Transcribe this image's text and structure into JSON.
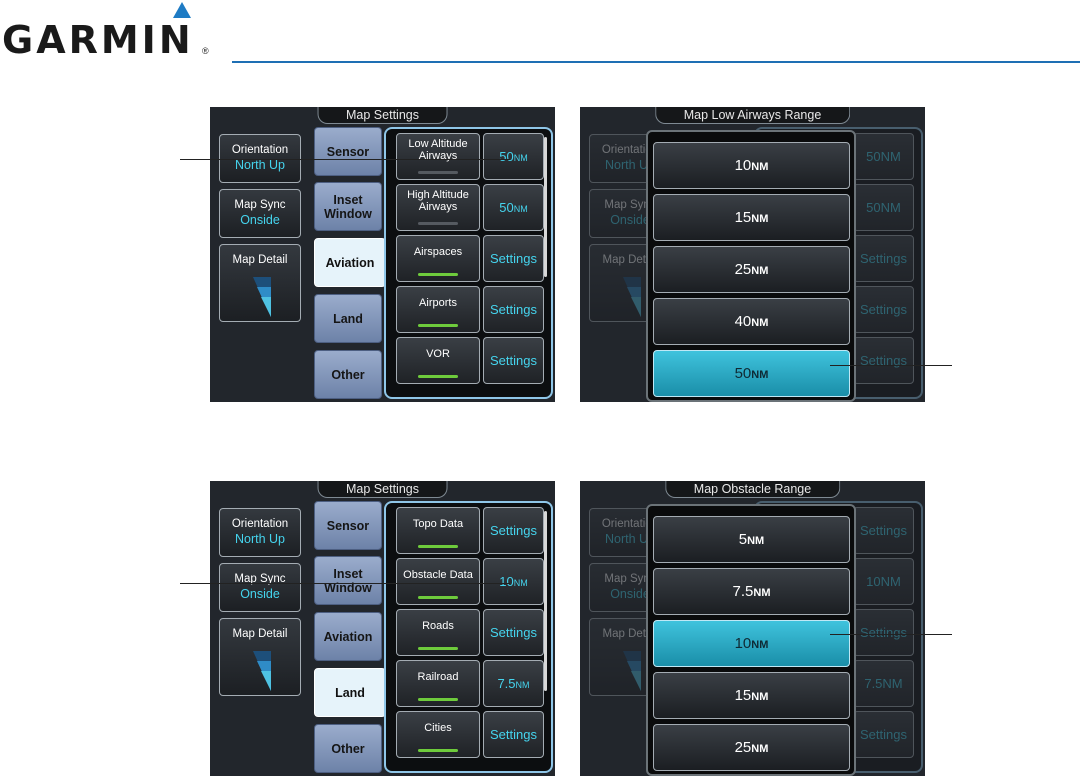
{
  "brand": {
    "name": "GARMIN",
    "mark": "®"
  },
  "top_left": {
    "title": "Map Settings",
    "left_buttons": [
      {
        "label": "Orientation",
        "value": "North Up"
      },
      {
        "label": "Map Sync",
        "value": "Onside"
      }
    ],
    "detail_label": "Map Detail",
    "tabs": [
      "Sensor",
      "Inset Window",
      "Aviation",
      "Land",
      "Other"
    ],
    "active_tab": "Aviation",
    "items": [
      {
        "label": "Low Altitude Airways",
        "value": "50",
        "unit": "NM",
        "enabled": false
      },
      {
        "label": "High Altitude Airways",
        "value": "50",
        "unit": "NM",
        "enabled": false
      },
      {
        "label": "Airspaces",
        "value": "Settings",
        "enabled": true
      },
      {
        "label": "Airports",
        "value": "Settings",
        "enabled": true
      },
      {
        "label": "VOR",
        "value": "Settings",
        "enabled": true
      }
    ]
  },
  "top_right": {
    "title": "Map Low Airways Range",
    "options": [
      {
        "value": "10",
        "unit": "NM"
      },
      {
        "value": "15",
        "unit": "NM"
      },
      {
        "value": "25",
        "unit": "NM"
      },
      {
        "value": "40",
        "unit": "NM"
      },
      {
        "value": "50",
        "unit": "NM"
      }
    ],
    "selected": "50",
    "bg": {
      "left_buttons": [
        {
          "label": "Orientation",
          "value": "North Up"
        },
        {
          "label": "Map Sync",
          "value": "Onside"
        }
      ],
      "detail_label": "Map Detail",
      "values": [
        "50NM",
        "50NM",
        "Settings",
        "Settings",
        "Settings"
      ]
    }
  },
  "bottom_left": {
    "title": "Map Settings",
    "left_buttons": [
      {
        "label": "Orientation",
        "value": "North Up"
      },
      {
        "label": "Map Sync",
        "value": "Onside"
      }
    ],
    "detail_label": "Map Detail",
    "tabs": [
      "Sensor",
      "Inset Window",
      "Aviation",
      "Land",
      "Other"
    ],
    "active_tab": "Land",
    "items": [
      {
        "label": "Topo Data",
        "value": "Settings",
        "enabled": true
      },
      {
        "label": "Obstacle Data",
        "value": "10",
        "unit": "NM",
        "enabled": true
      },
      {
        "label": "Roads",
        "value": "Settings",
        "enabled": true
      },
      {
        "label": "Railroad",
        "value": "7.5",
        "unit": "NM",
        "enabled": true
      },
      {
        "label": "Cities",
        "value": "Settings",
        "enabled": true
      }
    ]
  },
  "bottom_right": {
    "title": "Map Obstacle Range",
    "options": [
      {
        "value": "5",
        "unit": "NM"
      },
      {
        "value": "7.5",
        "unit": "NM"
      },
      {
        "value": "10",
        "unit": "NM"
      },
      {
        "value": "15",
        "unit": "NM"
      },
      {
        "value": "25",
        "unit": "NM"
      }
    ],
    "selected": "10",
    "bg": {
      "left_buttons": [
        {
          "label": "Orientation",
          "value": "North Up"
        },
        {
          "label": "Map Sync",
          "value": "Onside"
        }
      ],
      "detail_label": "Map Detail",
      "values": [
        "Settings",
        "10NM",
        "Settings",
        "7.5NM",
        "Settings"
      ]
    }
  },
  "colors": {
    "accent_cyan": "#45d4ee",
    "enabled_bar": "#6ecb3c",
    "selected_option": "#2aa8c4",
    "brand_blue": "#1e7bc4"
  }
}
